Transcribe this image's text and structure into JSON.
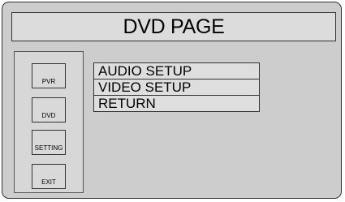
{
  "title": "DVD PAGE",
  "sidebar": {
    "buttons": [
      {
        "label": "PVR"
      },
      {
        "label": "DVD"
      },
      {
        "label": "SETTING"
      },
      {
        "label": "EXIT"
      }
    ]
  },
  "menu": {
    "items": [
      {
        "label": "AUDIO SETUP"
      },
      {
        "label": "VIDEO SETUP"
      },
      {
        "label": "RETURN"
      }
    ]
  }
}
